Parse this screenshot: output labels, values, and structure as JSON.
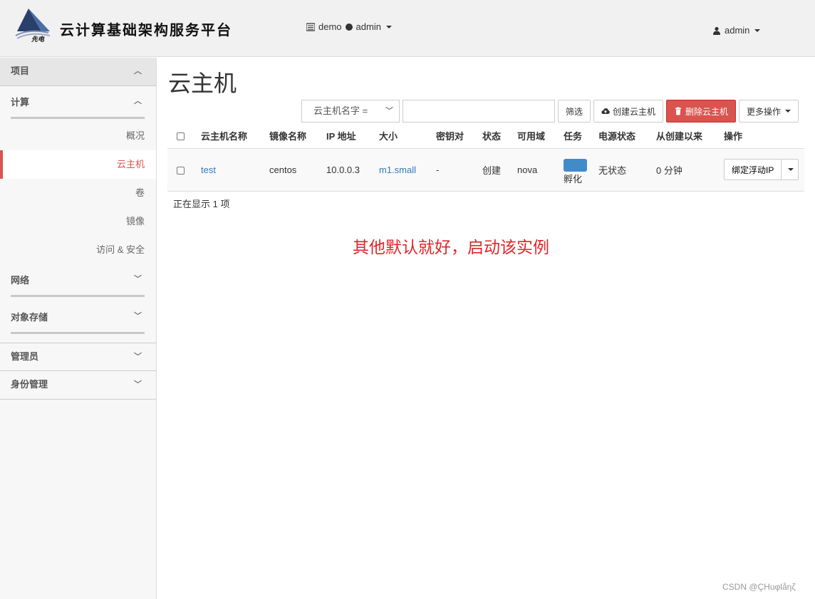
{
  "header": {
    "brand": "云计算基础架构服务平台",
    "logo_text": "先电",
    "project": "demo",
    "project_user": "admin",
    "user": "admin"
  },
  "sidebar": {
    "project": "项目",
    "compute": "计算",
    "compute_items": [
      "概况",
      "云主机",
      "卷",
      "镜像",
      "访问 & 安全"
    ],
    "network": "网络",
    "object_storage": "对象存储",
    "admin": "管理员",
    "identity": "身份管理"
  },
  "main": {
    "title": "云主机",
    "filter_select": "云主机名字 =",
    "filter_input_value": "",
    "filter_button": "筛选",
    "create_button": "创建云主机",
    "delete_button": "删除云主机",
    "more_button": "更多操作",
    "columns": [
      "云主机名称",
      "镜像名称",
      "IP 地址",
      "大小",
      "密钥对",
      "状态",
      "可用域",
      "任务",
      "电源状态",
      "从创建以来",
      "操作"
    ],
    "rows": [
      {
        "name": "test",
        "image": "centos",
        "ip": "10.0.0.3",
        "size": "m1.small",
        "keypair": "-",
        "status": "创建",
        "zone": "nova",
        "task": "孵化",
        "power": "无状态",
        "age": "0 分钟",
        "action": "绑定浮动IP"
      }
    ],
    "count_text": "正在显示 1 项"
  },
  "annotation": "其他默认就好，启动该实例",
  "watermark": "CSDN @ÇHuφlåηζ",
  "colors": {
    "accent": "#d9534f",
    "link": "#337ab7",
    "annotation": "#e0262a",
    "task_bar": "#428bca"
  }
}
